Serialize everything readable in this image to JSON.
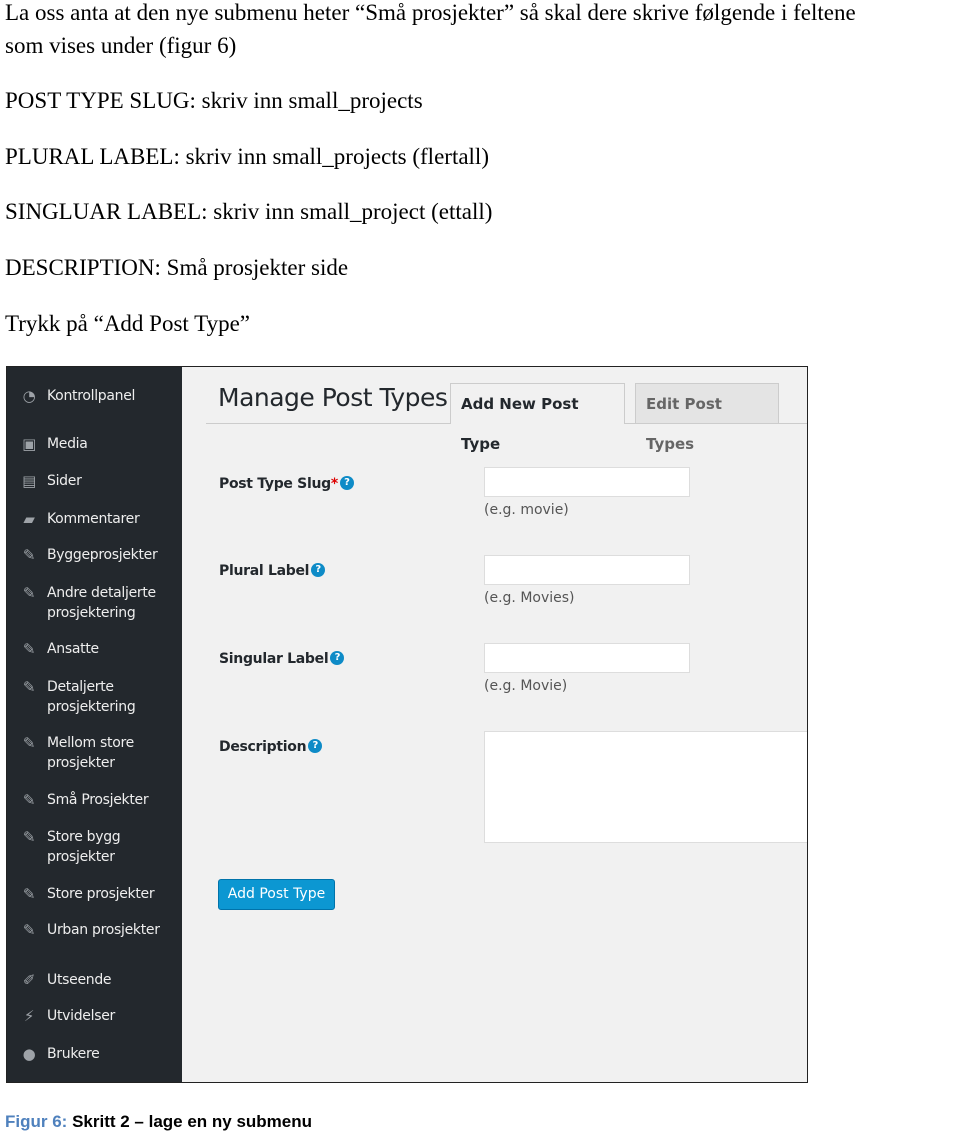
{
  "paragraphs": [
    "La oss anta at den nye submenu heter “Små prosjekter” så skal dere skrive følgende i feltene",
    "som vises under (figur 6)",
    "POST TYPE SLUG: skriv inn small_projects",
    "PLURAL LABEL: skriv inn small_projects (flertall)",
    "SINGLUAR LABEL: skriv inn small_project (ettall)",
    "DESCRIPTION: Små prosjekter side",
    "Trykk på “Add Post Type”"
  ],
  "sidebar": {
    "items": [
      {
        "label": "Kontrollpanel",
        "icon": "dashboard-icon"
      },
      {
        "label": "Media",
        "icon": "media-icon"
      },
      {
        "label": "Sider",
        "icon": "pages-icon"
      },
      {
        "label": "Kommentarer",
        "icon": "comments-icon"
      },
      {
        "label": "Byggeprosjekter",
        "icon": "pin-icon"
      },
      {
        "label": "Andre detaljerte prosjektering",
        "icon": "pin-icon"
      },
      {
        "label": "Ansatte",
        "icon": "pin-icon"
      },
      {
        "label": "Detaljerte prosjektering",
        "icon": "pin-icon"
      },
      {
        "label": "Mellom store prosjekter",
        "icon": "pin-icon"
      },
      {
        "label": "Små Prosjekter",
        "icon": "pin-icon"
      },
      {
        "label": "Store bygg prosjekter",
        "icon": "pin-icon"
      },
      {
        "label": "Store prosjekter",
        "icon": "pin-icon"
      },
      {
        "label": "Urban prosjekter",
        "icon": "pin-icon"
      },
      {
        "label": "Utseende",
        "icon": "brush-icon"
      },
      {
        "label": "Utvidelser",
        "icon": "plugin-icon"
      },
      {
        "label": "Brukere",
        "icon": "user-icon"
      }
    ]
  },
  "main": {
    "title": "Manage Post Types",
    "tabs": [
      {
        "label": "Add New Post Type",
        "active": true
      },
      {
        "label": "Edit Post Types",
        "active": false
      }
    ],
    "fields": [
      {
        "label": "Post Type Slug",
        "required": "*",
        "help": "?",
        "value": "",
        "hint": "(e.g. movie)"
      },
      {
        "label": "Plural Label",
        "help": "?",
        "value": "",
        "hint": "(e.g. Movies)"
      },
      {
        "label": "Singular Label",
        "help": "?",
        "value": "",
        "hint": "(e.g. Movie)"
      },
      {
        "label": "Description",
        "help": "?",
        "value": ""
      }
    ],
    "submit": "Add Post Type"
  },
  "caption": {
    "prefix": "Figur 6:",
    "text": " Skritt 2 – lage en ny submenu"
  },
  "colors": {
    "sidebar": "#23282d",
    "content": "#f1f1f1",
    "button": "#0c97d2",
    "caption_prefix": "#4f81bd"
  }
}
